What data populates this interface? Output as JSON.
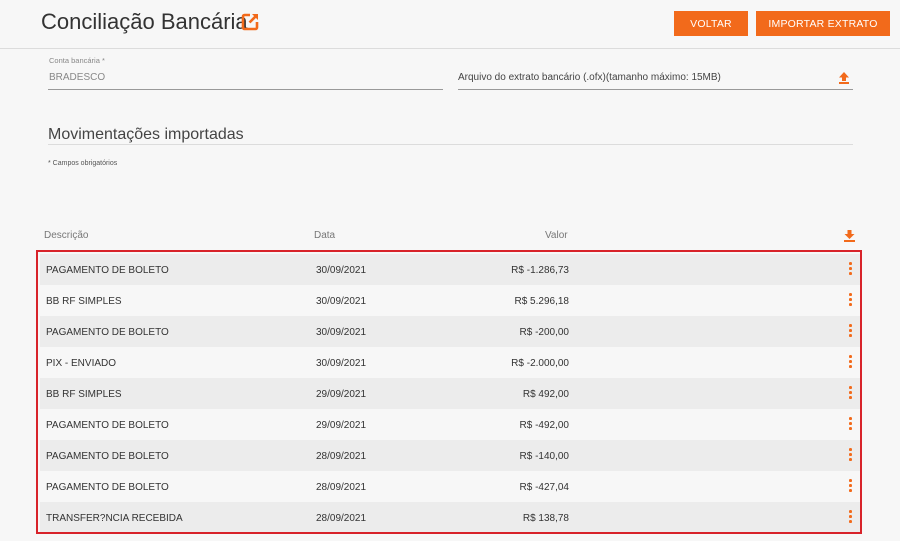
{
  "header": {
    "title": "Conciliação Bancária",
    "title_icon": "external-link-icon",
    "back_label": "VOLTAR",
    "import_label": "IMPORTAR EXTRATO"
  },
  "form": {
    "account_label": "Conta bancária *",
    "account_value": "BRADESCO",
    "file_label": "Arquivo do extrato bancário (.ofx)(tamanho máximo: 15MB)",
    "upload_icon": "upload-icon"
  },
  "section": {
    "title": "Movimentações importadas",
    "required_note": "* Campos obrigatórios"
  },
  "table": {
    "headers": {
      "description": "Descrição",
      "date": "Data",
      "value": "Valor"
    },
    "download_icon": "download-icon",
    "rows": [
      {
        "description": "PAGAMENTO DE BOLETO",
        "date": "30/09/2021",
        "value": "R$ -1.286,73"
      },
      {
        "description": "BB RF SIMPLES",
        "date": "30/09/2021",
        "value": "R$ 5.296,18"
      },
      {
        "description": "PAGAMENTO DE BOLETO",
        "date": "30/09/2021",
        "value": "R$ -200,00"
      },
      {
        "description": "PIX - ENVIADO",
        "date": "30/09/2021",
        "value": "R$ -2.000,00"
      },
      {
        "description": "BB RF SIMPLES",
        "date": "29/09/2021",
        "value": "R$ 492,00"
      },
      {
        "description": "PAGAMENTO DE BOLETO",
        "date": "29/09/2021",
        "value": "R$ -492,00"
      },
      {
        "description": "PAGAMENTO DE BOLETO",
        "date": "28/09/2021",
        "value": "R$ -140,00"
      },
      {
        "description": "PAGAMENTO DE BOLETO",
        "date": "28/09/2021",
        "value": "R$ -427,04"
      },
      {
        "description": "TRANSFER?NCIA RECEBIDA",
        "date": "28/09/2021",
        "value": "R$ 138,78"
      }
    ]
  },
  "colors": {
    "accent": "#f26a1b",
    "highlight_border": "#d8232a"
  }
}
